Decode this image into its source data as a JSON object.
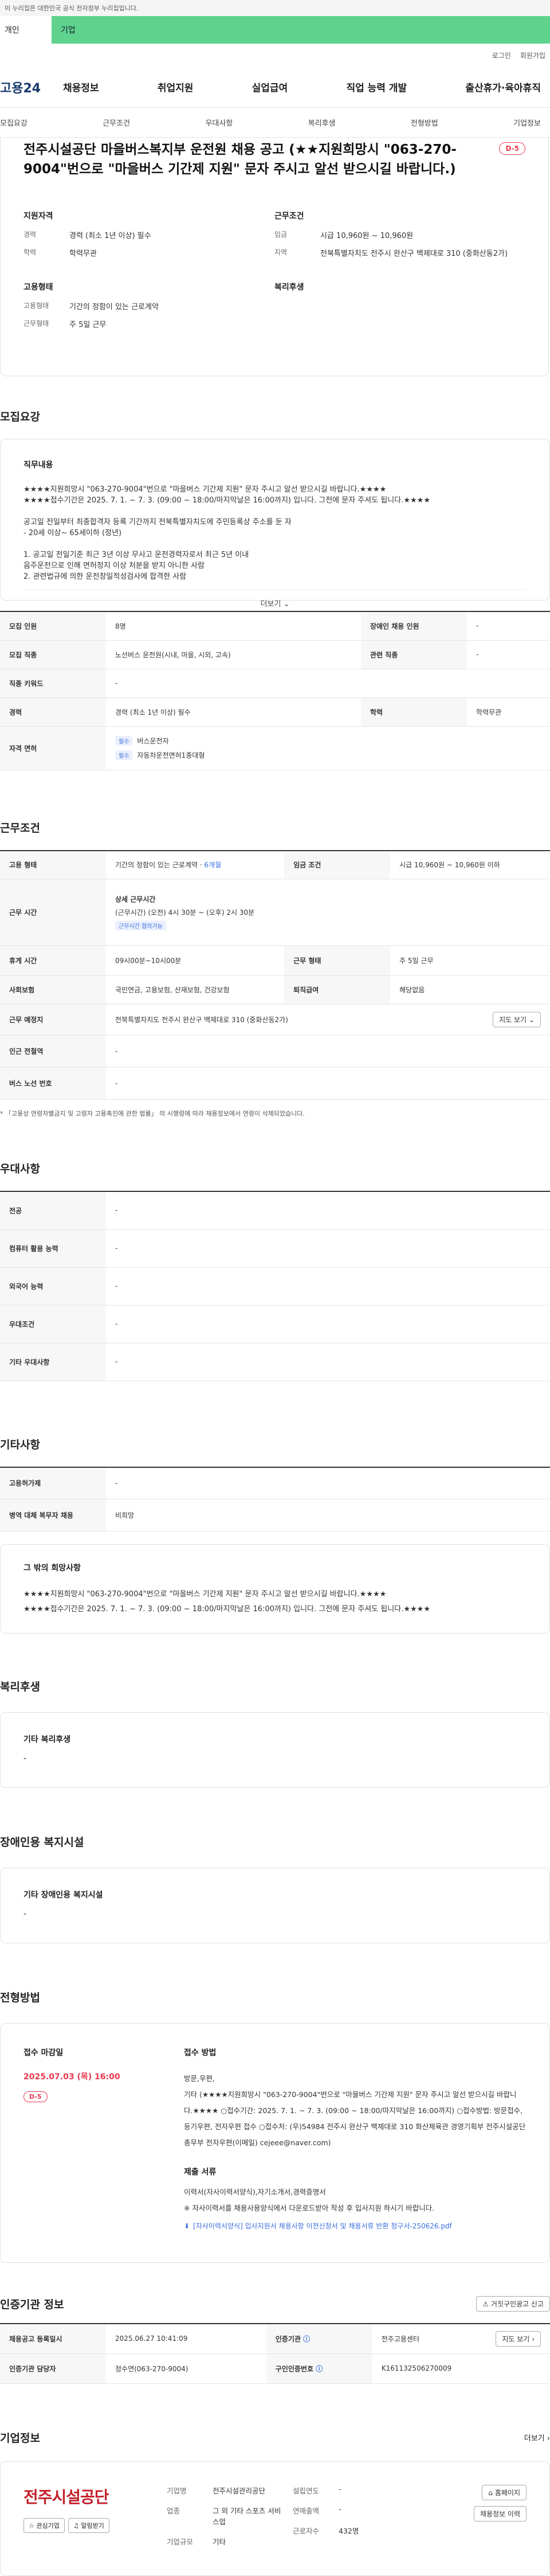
{
  "gov_notice": "이 누리집은 대한민국 공식 전자정부 누리집입니다.",
  "site_tabs": {
    "personal": "개인",
    "corporate": "기업"
  },
  "util": {
    "login": "로그인",
    "signup": "회원가입"
  },
  "logo": "고용24",
  "gnb": [
    "채용정보",
    "취업지원",
    "실업급여",
    "직업 능력 개발",
    "출산휴가·육아휴직"
  ],
  "anchor_nav": [
    "모집요강",
    "근무조건",
    "우대사항",
    "복리후생",
    "전형방법",
    "기업정보"
  ],
  "hero": {
    "title": "전주시설공단 마을버스복지부 운전원 채용 공고 (★★지원희망시 \"063-270-9004\"번으로 \"마을버스 기간제 지원\" 문자 주시고 알선 받으시길 바랍니다.)",
    "dday": "D-5",
    "qual_title": "지원자격",
    "qual": [
      {
        "k": "경력",
        "v": "경력 (최소 1년 이상) 필수"
      },
      {
        "k": "학력",
        "v": "학력무관"
      }
    ],
    "work_title": "근무조건",
    "work": [
      {
        "k": "임금",
        "v": "시급 10,960원 ~ 10,960원"
      },
      {
        "k": "지역",
        "v": "전북특별자치도 전주시 완산구 백제대로 310 (중화산동2가)"
      }
    ],
    "emp_title": "고용형태",
    "emp": [
      {
        "k": "고용형태",
        "v": "기간의 정함이 있는 근로계약"
      },
      {
        "k": "근무형태",
        "v": "주 5일 근무"
      }
    ],
    "welfare_title": "복리후생"
  },
  "recruit": {
    "section": "모집요강",
    "job_title": "직무내용",
    "job_text": "★★★★지원희망시 \"063-270-9004\"번으로 \"마을버스 기간제 지원\" 문자 주시고 알선 받으시길 바랍니다.★★★★\n★★★★접수기간은 2025. 7. 1. ~ 7. 3. (09:00 ~ 18:00/마지막날은 16:00까지) 입니다. 그전에 문자 주셔도 됩니다.★★★★\n\n공고일 전일부터 최종합격자 등록 기간까지 전북특별자치도에 주민등록상 주소를 둔 자\n- 20세 이상~ 65세이하 (정년)\n\n1. 공고일 전일기준 최근 3년 이상 무사고 운전경력자로서 최근 5년 이내\n   음주운전으로 인해 면허정지 이상 처분을 받지 아니한 사람\n2. 관련법규에 의한 운전창일적성검사에 합격한 사람",
    "more": "더보기",
    "rows": [
      {
        "k1": "모집 인원",
        "v1": "8명",
        "k2": "장애인 채용 인원",
        "v2": "-"
      },
      {
        "k1": "모집 직종",
        "v1": "노선버스 운전원(시내, 마을, 시외, 고속)",
        "k2": "관련 직종",
        "v2": "-"
      },
      {
        "k1": "직종 키워드",
        "v1": "-"
      },
      {
        "k1": "경력",
        "v1": "경력 (최소 1년 이상) 필수",
        "k2": "학력",
        "v2": "학력무관"
      }
    ],
    "license_label": "자격 면허",
    "licenses": [
      {
        "tag": "필수",
        "name": "버스운전자"
      },
      {
        "tag": "필수",
        "name": "자동차운전면허1종대형"
      }
    ]
  },
  "work": {
    "section": "근무조건",
    "emp_label": "고용 형태",
    "emp_value": "기간의 정함이 있는 근로계약",
    "emp_period": "6개월",
    "wage_label": "임금 조건",
    "wage_value": "시급 10,960원 ~ 10,960원 이하",
    "hours_label": "근무 시간",
    "hours_title": "상세 근무시간",
    "hours_value": "(근무시간) (오전) 4시 30분 ~ (오후) 2시 30분",
    "hours_tag": "근무시간 협의가능",
    "rest_label": "휴게 시간",
    "rest_value": "09시00분~10시00분",
    "type_label": "근무 형태",
    "type_value": "주 5일 근무",
    "ins_label": "사회보험",
    "ins_value": "국민연금, 고용보험, 산재보험, 건강보험",
    "retire_label": "퇴직급여",
    "retire_value": "해당없음",
    "place_label": "근무 예정지",
    "place_value": "전북특별자치도 전주시 완산구 백제대로 310 (중화산동2가)",
    "map_btn": "지도 보기",
    "subway_label": "인근 전철역",
    "subway_value": "-",
    "bus_label": "버스 노선 번호",
    "bus_value": "-",
    "note": "* 「고용상 연령차별금지 및 고령자 고용촉진에 관한 법률」 의 시행령에 따라 채용정보에서 연령이 삭제되었습니다."
  },
  "pref": {
    "section": "우대사항",
    "rows": [
      {
        "k": "전공",
        "v": "-"
      },
      {
        "k": "컴퓨터 활용 능력",
        "v": "-"
      },
      {
        "k": "외국어 능력",
        "v": "-"
      },
      {
        "k": "우대조건",
        "v": "-"
      },
      {
        "k": "기타 우대사항",
        "v": "-"
      }
    ]
  },
  "etc": {
    "section": "기타사항",
    "rows": [
      {
        "k": "고용허가제",
        "v": "-"
      },
      {
        "k": "병역 대체 복무자 채용",
        "v": "비희망"
      }
    ],
    "hope_title": "그 밖의 희망사항",
    "hope_text": "★★★★지원희망시 \"063-270-9004\"번으로 \"마을버스 기간제 지원\" 문자 주시고 알선 받으시길 바랍니다.★★★★\n★★★★접수기간은 2025. 7. 1. ~ 7. 3. (09:00 ~ 18:00/마지막날은 16:00까지) 입니다. 그전에 문자 주셔도 됩니다.★★★★"
  },
  "welfare": {
    "section": "복리후생",
    "title": "기타 복리후생",
    "value": "-"
  },
  "disability": {
    "section": "장애인용 복지시설",
    "title": "기타 장애인용 복지시설",
    "value": "-"
  },
  "screening": {
    "section": "전형방법",
    "deadline_title": "접수 마감일",
    "deadline": "2025.07.03 (목) 16:00",
    "dday": "D-5",
    "method_title": "접수 방법",
    "method_text": "방문,우편,\n기타 (★★★★지원희망시 \"063-270-9004\"번으로 \"마을버스 기간제 지원\" 문자 주시고 알선 받으시길 바랍니다.★★★★ ○접수기간: 2025. 7. 1. ~ 7. 3. (09:00 ~ 18:00/마지막날은 16:00까지)  ○접수방법: 방문접수, 등기우편, 전자우편 접수  ○접수처: (우)54984 전주시 완산구 백제대로 310 화산체육관 경영기획부                           전주시설공단 총무부 전자우편(이메일) cejeee@naver.com)",
    "docs_title": "제출 서류",
    "docs_text": "이력서(자사이력서양식),자기소개서,경력증명서\n※ 자사이력서를 채용사용양식에서 다운로드받아 작성 후 입사지원 하시기 바랍니다.",
    "file": "[자사이력서양식] 입사지원서 채용사항 이전신청서 및 채용서류 반환 청구서-250626.pdf"
  },
  "cert": {
    "section": "인증기관 정보",
    "verify_btn": "거짓구인광고 신고",
    "rows": [
      {
        "k1": "채용공고 등록일시",
        "v1": "2025.06.27 10:41:09",
        "k2": "인증기관",
        "v2": "전주고용센터",
        "btn": "지도 보기"
      },
      {
        "k1": "인증기관 담당자",
        "v1": "정수연(063-270-9004)",
        "k2": "구인인증번호",
        "v2": "K161132506270009"
      }
    ]
  },
  "company": {
    "section": "기업정보",
    "more": "더보기",
    "logo_text": "전주시설공단",
    "fav_btn": "관심기업",
    "alert_btn": "알림받기",
    "left": [
      {
        "k": "기업명",
        "v": "전주시설관리공단"
      },
      {
        "k": "업종",
        "v": "그 외 기타 스포츠 서비스업"
      },
      {
        "k": "기업규모",
        "v": "기타"
      }
    ],
    "right": [
      {
        "k": "설립연도",
        "v": "-"
      },
      {
        "k": "연매출액",
        "v": "-"
      },
      {
        "k": "근로자수",
        "v": "432명"
      }
    ],
    "homepage_btn": "홈페이지",
    "jobs_btn": "채용정보 이력"
  }
}
